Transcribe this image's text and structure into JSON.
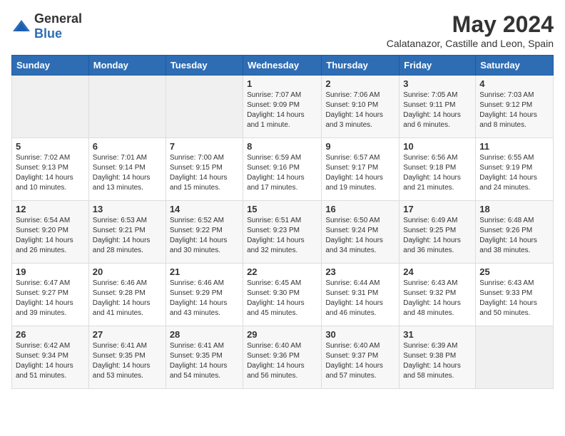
{
  "header": {
    "logo_general": "General",
    "logo_blue": "Blue",
    "month_title": "May 2024",
    "location": "Calatanazor, Castille and Leon, Spain"
  },
  "weekdays": [
    "Sunday",
    "Monday",
    "Tuesday",
    "Wednesday",
    "Thursday",
    "Friday",
    "Saturday"
  ],
  "weeks": [
    [
      {
        "day": "",
        "sunrise": "",
        "sunset": "",
        "daylight": ""
      },
      {
        "day": "",
        "sunrise": "",
        "sunset": "",
        "daylight": ""
      },
      {
        "day": "",
        "sunrise": "",
        "sunset": "",
        "daylight": ""
      },
      {
        "day": "1",
        "sunrise": "Sunrise: 7:07 AM",
        "sunset": "Sunset: 9:09 PM",
        "daylight": "Daylight: 14 hours and 1 minute."
      },
      {
        "day": "2",
        "sunrise": "Sunrise: 7:06 AM",
        "sunset": "Sunset: 9:10 PM",
        "daylight": "Daylight: 14 hours and 3 minutes."
      },
      {
        "day": "3",
        "sunrise": "Sunrise: 7:05 AM",
        "sunset": "Sunset: 9:11 PM",
        "daylight": "Daylight: 14 hours and 6 minutes."
      },
      {
        "day": "4",
        "sunrise": "Sunrise: 7:03 AM",
        "sunset": "Sunset: 9:12 PM",
        "daylight": "Daylight: 14 hours and 8 minutes."
      }
    ],
    [
      {
        "day": "5",
        "sunrise": "Sunrise: 7:02 AM",
        "sunset": "Sunset: 9:13 PM",
        "daylight": "Daylight: 14 hours and 10 minutes."
      },
      {
        "day": "6",
        "sunrise": "Sunrise: 7:01 AM",
        "sunset": "Sunset: 9:14 PM",
        "daylight": "Daylight: 14 hours and 13 minutes."
      },
      {
        "day": "7",
        "sunrise": "Sunrise: 7:00 AM",
        "sunset": "Sunset: 9:15 PM",
        "daylight": "Daylight: 14 hours and 15 minutes."
      },
      {
        "day": "8",
        "sunrise": "Sunrise: 6:59 AM",
        "sunset": "Sunset: 9:16 PM",
        "daylight": "Daylight: 14 hours and 17 minutes."
      },
      {
        "day": "9",
        "sunrise": "Sunrise: 6:57 AM",
        "sunset": "Sunset: 9:17 PM",
        "daylight": "Daylight: 14 hours and 19 minutes."
      },
      {
        "day": "10",
        "sunrise": "Sunrise: 6:56 AM",
        "sunset": "Sunset: 9:18 PM",
        "daylight": "Daylight: 14 hours and 21 minutes."
      },
      {
        "day": "11",
        "sunrise": "Sunrise: 6:55 AM",
        "sunset": "Sunset: 9:19 PM",
        "daylight": "Daylight: 14 hours and 24 minutes."
      }
    ],
    [
      {
        "day": "12",
        "sunrise": "Sunrise: 6:54 AM",
        "sunset": "Sunset: 9:20 PM",
        "daylight": "Daylight: 14 hours and 26 minutes."
      },
      {
        "day": "13",
        "sunrise": "Sunrise: 6:53 AM",
        "sunset": "Sunset: 9:21 PM",
        "daylight": "Daylight: 14 hours and 28 minutes."
      },
      {
        "day": "14",
        "sunrise": "Sunrise: 6:52 AM",
        "sunset": "Sunset: 9:22 PM",
        "daylight": "Daylight: 14 hours and 30 minutes."
      },
      {
        "day": "15",
        "sunrise": "Sunrise: 6:51 AM",
        "sunset": "Sunset: 9:23 PM",
        "daylight": "Daylight: 14 hours and 32 minutes."
      },
      {
        "day": "16",
        "sunrise": "Sunrise: 6:50 AM",
        "sunset": "Sunset: 9:24 PM",
        "daylight": "Daylight: 14 hours and 34 minutes."
      },
      {
        "day": "17",
        "sunrise": "Sunrise: 6:49 AM",
        "sunset": "Sunset: 9:25 PM",
        "daylight": "Daylight: 14 hours and 36 minutes."
      },
      {
        "day": "18",
        "sunrise": "Sunrise: 6:48 AM",
        "sunset": "Sunset: 9:26 PM",
        "daylight": "Daylight: 14 hours and 38 minutes."
      }
    ],
    [
      {
        "day": "19",
        "sunrise": "Sunrise: 6:47 AM",
        "sunset": "Sunset: 9:27 PM",
        "daylight": "Daylight: 14 hours and 39 minutes."
      },
      {
        "day": "20",
        "sunrise": "Sunrise: 6:46 AM",
        "sunset": "Sunset: 9:28 PM",
        "daylight": "Daylight: 14 hours and 41 minutes."
      },
      {
        "day": "21",
        "sunrise": "Sunrise: 6:46 AM",
        "sunset": "Sunset: 9:29 PM",
        "daylight": "Daylight: 14 hours and 43 minutes."
      },
      {
        "day": "22",
        "sunrise": "Sunrise: 6:45 AM",
        "sunset": "Sunset: 9:30 PM",
        "daylight": "Daylight: 14 hours and 45 minutes."
      },
      {
        "day": "23",
        "sunrise": "Sunrise: 6:44 AM",
        "sunset": "Sunset: 9:31 PM",
        "daylight": "Daylight: 14 hours and 46 minutes."
      },
      {
        "day": "24",
        "sunrise": "Sunrise: 6:43 AM",
        "sunset": "Sunset: 9:32 PM",
        "daylight": "Daylight: 14 hours and 48 minutes."
      },
      {
        "day": "25",
        "sunrise": "Sunrise: 6:43 AM",
        "sunset": "Sunset: 9:33 PM",
        "daylight": "Daylight: 14 hours and 50 minutes."
      }
    ],
    [
      {
        "day": "26",
        "sunrise": "Sunrise: 6:42 AM",
        "sunset": "Sunset: 9:34 PM",
        "daylight": "Daylight: 14 hours and 51 minutes."
      },
      {
        "day": "27",
        "sunrise": "Sunrise: 6:41 AM",
        "sunset": "Sunset: 9:35 PM",
        "daylight": "Daylight: 14 hours and 53 minutes."
      },
      {
        "day": "28",
        "sunrise": "Sunrise: 6:41 AM",
        "sunset": "Sunset: 9:35 PM",
        "daylight": "Daylight: 14 hours and 54 minutes."
      },
      {
        "day": "29",
        "sunrise": "Sunrise: 6:40 AM",
        "sunset": "Sunset: 9:36 PM",
        "daylight": "Daylight: 14 hours and 56 minutes."
      },
      {
        "day": "30",
        "sunrise": "Sunrise: 6:40 AM",
        "sunset": "Sunset: 9:37 PM",
        "daylight": "Daylight: 14 hours and 57 minutes."
      },
      {
        "day": "31",
        "sunrise": "Sunrise: 6:39 AM",
        "sunset": "Sunset: 9:38 PM",
        "daylight": "Daylight: 14 hours and 58 minutes."
      },
      {
        "day": "",
        "sunrise": "",
        "sunset": "",
        "daylight": ""
      }
    ]
  ]
}
